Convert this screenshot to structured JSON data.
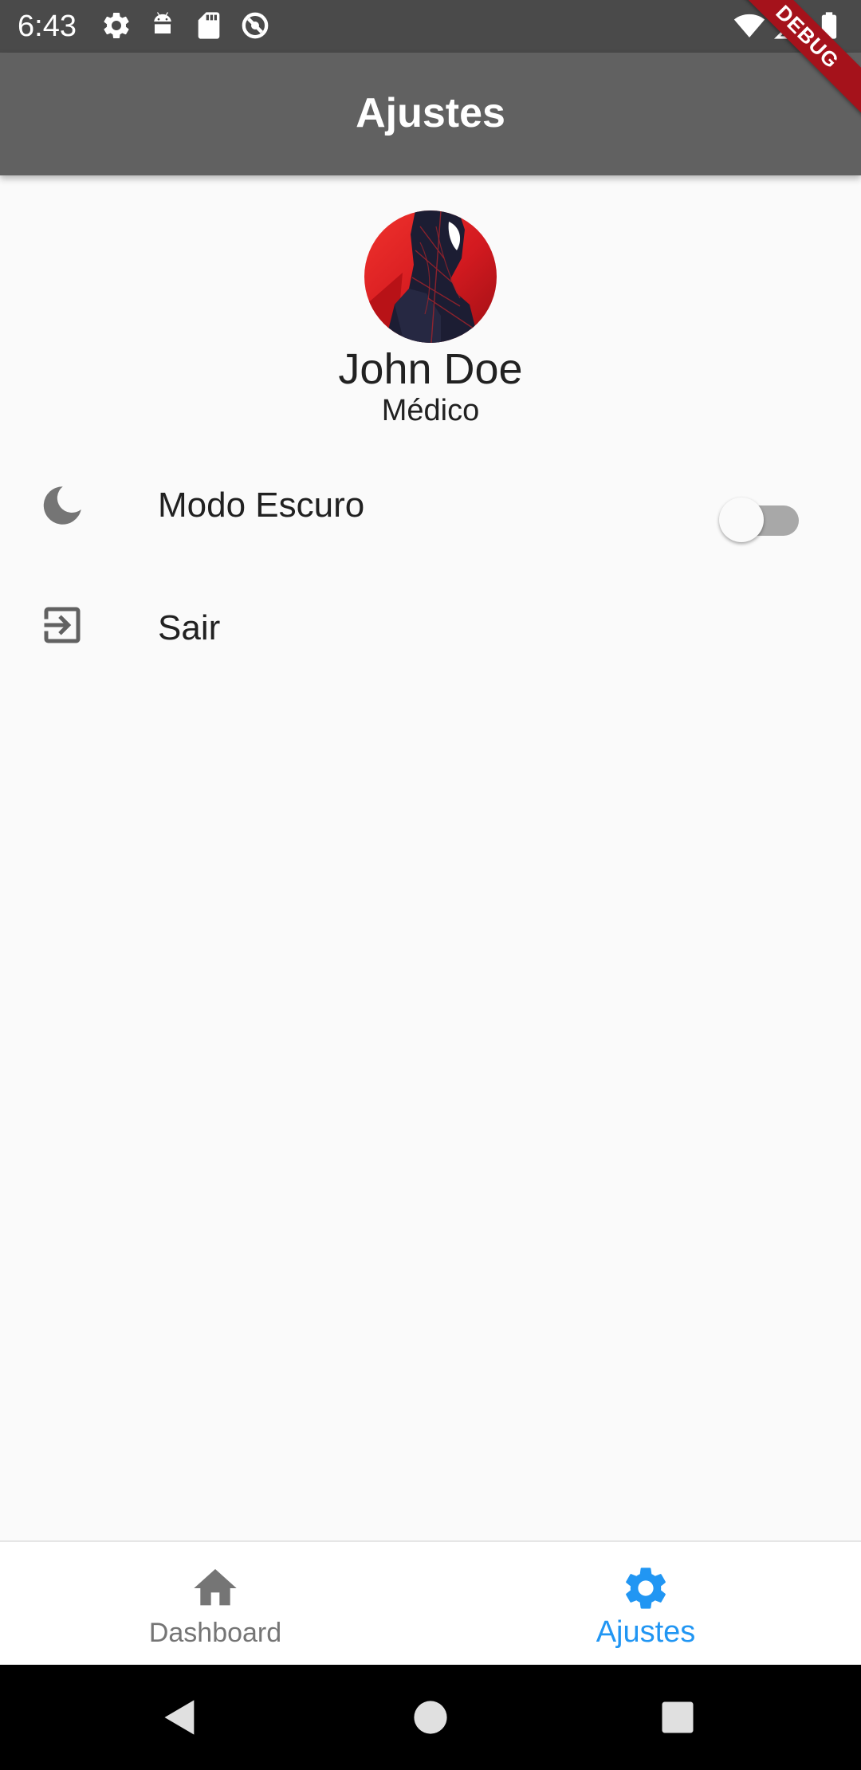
{
  "status_bar": {
    "time": "6:43",
    "left_icons": [
      "settings-icon",
      "android-icon",
      "sd-card-icon",
      "data-saver-icon"
    ],
    "right_icons": [
      "wifi-icon",
      "signal-icon",
      "battery-icon"
    ]
  },
  "debug_banner": {
    "label": "DEBUG"
  },
  "app_bar": {
    "title": "Ajustes"
  },
  "profile": {
    "name": "John Doe",
    "role": "Médico",
    "avatar_icon": "spiderman-avatar"
  },
  "settings": {
    "dark_mode": {
      "label": "Modo Escuro",
      "icon": "moon-icon",
      "enabled": false
    },
    "logout": {
      "label": "Sair",
      "icon": "exit-icon"
    }
  },
  "bottom_nav": {
    "items": [
      {
        "label": "Dashboard",
        "icon": "home-icon",
        "active": false
      },
      {
        "label": "Ajustes",
        "icon": "settings-icon",
        "active": true
      }
    ]
  },
  "colors": {
    "app_bar": "#616161",
    "status_bar": "#4a4a4a",
    "active_nav": "#2196f3",
    "inactive_nav": "#757575",
    "background": "#fafafa"
  }
}
